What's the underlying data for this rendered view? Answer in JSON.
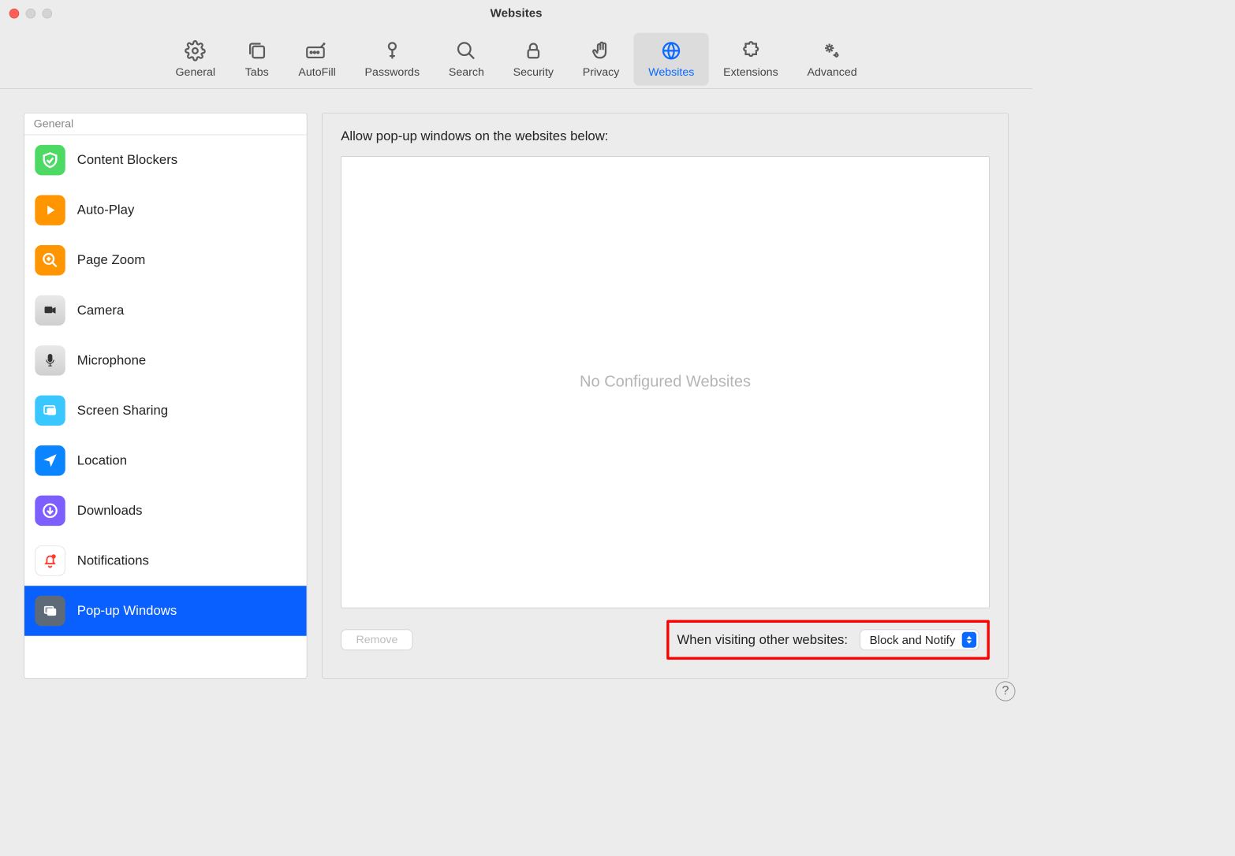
{
  "window": {
    "title": "Websites"
  },
  "toolbar": {
    "items": [
      {
        "label": "General"
      },
      {
        "label": "Tabs"
      },
      {
        "label": "AutoFill"
      },
      {
        "label": "Passwords"
      },
      {
        "label": "Search"
      },
      {
        "label": "Security"
      },
      {
        "label": "Privacy"
      },
      {
        "label": "Websites"
      },
      {
        "label": "Extensions"
      },
      {
        "label": "Advanced"
      }
    ]
  },
  "sidebar": {
    "header": "General",
    "items": [
      {
        "label": "Content Blockers"
      },
      {
        "label": "Auto-Play"
      },
      {
        "label": "Page Zoom"
      },
      {
        "label": "Camera"
      },
      {
        "label": "Microphone"
      },
      {
        "label": "Screen Sharing"
      },
      {
        "label": "Location"
      },
      {
        "label": "Downloads"
      },
      {
        "label": "Notifications"
      },
      {
        "label": "Pop-up Windows"
      }
    ]
  },
  "main": {
    "heading": "Allow pop-up windows on the websites below:",
    "empty_text": "No Configured Websites",
    "remove_label": "Remove",
    "other_label": "When visiting other websites:",
    "select_value": "Block and Notify"
  },
  "help": {
    "label": "?"
  },
  "colors": {
    "accent": "#0a69ff",
    "highlight": "#ff0000",
    "sidebar_icon_green": "#4cd964",
    "sidebar_icon_orange": "#ff9500",
    "sidebar_icon_gray": "#d8d8d8",
    "sidebar_icon_blue": "#0a84ff",
    "sidebar_icon_purple": "#7d5fff",
    "sidebar_icon_white": "#ffffff"
  }
}
